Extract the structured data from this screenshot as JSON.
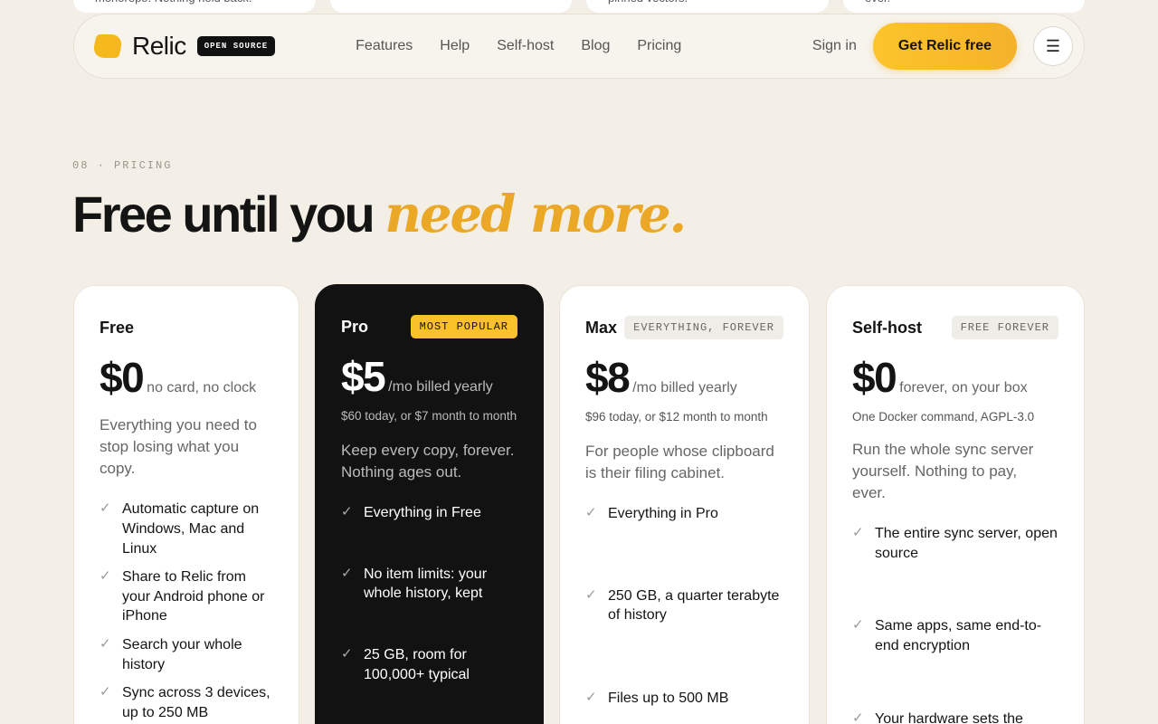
{
  "peek": [
    {
      "text": "monorepo. Nothing held back."
    },
    {
      "text": ""
    },
    {
      "text": "pinned vectors."
    },
    {
      "text": "ever."
    }
  ],
  "header": {
    "brand": "Relic",
    "badge": "OPEN SOURCE",
    "links": [
      "Features",
      "Help",
      "Self-host",
      "Blog",
      "Pricing"
    ],
    "signin": "Sign in",
    "cta": "Get Relic free",
    "menu_icon": "☰"
  },
  "section": {
    "eyebrow": "08 · PRICING",
    "headline_plain": "Free until you ",
    "headline_accent": "need more."
  },
  "plans": [
    {
      "name": "Free",
      "tag": "",
      "price": "$0",
      "price_note": "no card, no clock",
      "sub_note": "",
      "desc": "Everything you need to stop losing what you copy.",
      "features": [
        "Automatic capture on Windows, Mac and Linux",
        "Share to Relic from your Android phone or iPhone",
        "Search your whole history",
        "Sync across 3 devices, up to 250 MB"
      ]
    },
    {
      "name": "Pro",
      "tag": "MOST POPULAR",
      "price": "$5",
      "price_note": "/mo billed yearly",
      "sub_note": "$60 today, or $7 month to month",
      "desc": "Keep every copy, forever. Nothing ages out.",
      "features": [
        "Everything in Free",
        "No item limits: your whole history, kept",
        "25 GB, room for 100,000+ typical"
      ]
    },
    {
      "name": "Max",
      "tag": "EVERYTHING, FOREVER",
      "price": "$8",
      "price_note": "/mo billed yearly",
      "sub_note": "$96 today, or $12 month to month",
      "desc": "For people whose clipboard is their filing cabinet.",
      "features": [
        "Everything in Pro",
        "250 GB, a quarter terabyte of history",
        "Files up to 500 MB"
      ]
    },
    {
      "name": "Self-host",
      "tag": "FREE FOREVER",
      "price": "$0",
      "price_note": "forever, on your box",
      "sub_note": "One Docker command, AGPL-3.0",
      "desc": "Run the whole sync server yourself. Nothing to pay, ever.",
      "features": [
        "The entire sync server, open source",
        "Same apps, same end-to-end encryption",
        "Your hardware sets the"
      ]
    }
  ],
  "colors": {
    "accent": "#f5b81d",
    "background": "#f3efe6",
    "dark_card": "#121212"
  }
}
